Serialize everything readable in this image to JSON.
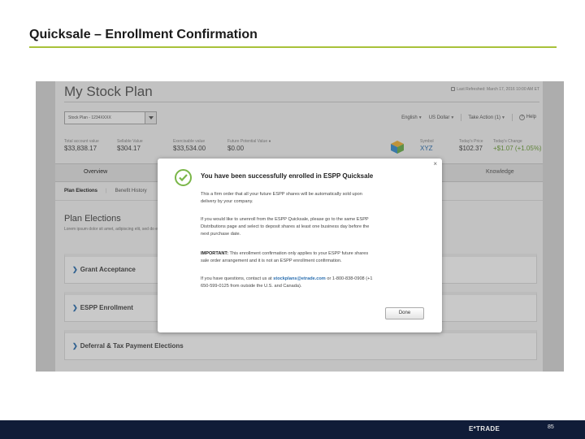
{
  "slide": {
    "title": "Quicksale – Enrollment Confirmation",
    "page_number": "85",
    "logo_text": "E*TRADE",
    "accent_color": "#a8c23a",
    "footer_color": "#101c38"
  },
  "app": {
    "title": "My Stock Plan",
    "last_refreshed": "Last Refreshed: March 17, 2016 10:00 AM ET",
    "plan_select": "Stock Plan - 1234XXXX",
    "controls": {
      "language": "English",
      "currency": "US Dollar",
      "take_action": "Take Action (1)",
      "help": "Help"
    },
    "stats": [
      {
        "label": "Total account value",
        "value": "$33,838.17"
      },
      {
        "label": "Sellable Value",
        "value": "$304.17"
      },
      {
        "label": "Exercisable value",
        "value": "$33,534.00"
      },
      {
        "label": "Future Potential Value",
        "value": "$0.00"
      },
      {
        "label": "Symbol",
        "value": "XYZ"
      },
      {
        "label": "Today's Price",
        "value": "$102.37"
      },
      {
        "label": "Today's Change",
        "value": "+$1.07 (+1.05%)"
      }
    ],
    "tabs": [
      "Overview",
      "Knowledge"
    ],
    "subnav": [
      "Plan Elections",
      "Benefit History"
    ],
    "elections_title": "Plan Elections",
    "elections_desc": "Lorem ipsum dolor sit amet, adipiscing elit, sed do eiusmod tempor incididunt ut labore",
    "accordions": [
      "Grant Acceptance",
      "ESPP Enrollment",
      "Deferral & Tax Payment Elections"
    ]
  },
  "modal": {
    "close": "×",
    "heading": "You have been successfully enrolled in ESPP Quicksale",
    "p1_l1": "This a firm order that all your future ESPP shares will be automatically sold upon",
    "p1_l2": "delivery by your company.",
    "p2_l1": "If you would like to unenroll from the ESPP Quicksale, please go to the same ESPP",
    "p2_l2": "Distributions page and select to deposit shares at least one business day before the",
    "p2_l3": "next purchase date.",
    "p3_bold": "IMPORTANT:",
    "p3_l1": " This enrollment confirmation only applies to your ESPP future shares",
    "p3_l2": "sale order arrangement and it is not an ESPP enrollment confirmation.",
    "p4_pre": "If you have questions, contact us at ",
    "p4_email": "stockplans@etrade.com",
    "p4_post": " or 1-800-838-0908 (+1",
    "p4_l2": "650-599-0125 from outside the U.S. and Canada).",
    "done": "Done"
  }
}
